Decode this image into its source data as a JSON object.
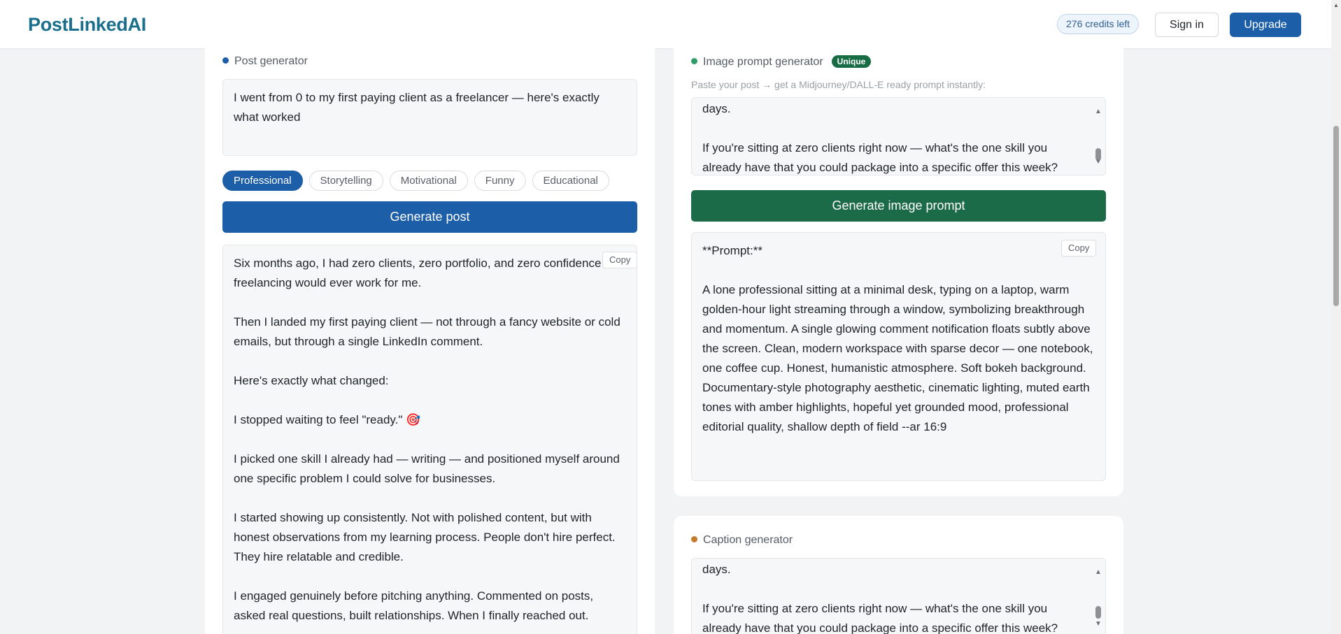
{
  "header": {
    "brand": "PostLinkedAI",
    "credits": "276 credits left",
    "signin": "Sign in",
    "upgrade": "Upgrade"
  },
  "post_generator": {
    "title": "Post generator",
    "dot_color": "#1d5ea8",
    "input_value": "I went from 0 to my first paying client as a freelancer — here's exactly what worked",
    "tones": [
      {
        "label": "Professional",
        "active": true
      },
      {
        "label": "Storytelling",
        "active": false
      },
      {
        "label": "Motivational",
        "active": false
      },
      {
        "label": "Funny",
        "active": false
      },
      {
        "label": "Educational",
        "active": false
      }
    ],
    "generate_label": "Generate post",
    "copy_label": "Copy",
    "output_text": "Six months ago, I had zero clients, zero portfolio, and zero confidence that freelancing would ever work for me.\n\nThen I landed my first paying client — not through a fancy website or cold emails, but through a single LinkedIn comment.\n\nHere's exactly what changed:\n\nI stopped waiting to feel \"ready.\" 🎯\n\nI picked one skill I already had — writing — and positioned myself around one specific problem I could solve for businesses.\n\nI started showing up consistently. Not with polished content, but with honest observations from my learning process. People don't hire perfect. They hire relatable and credible.\n\nI engaged genuinely before pitching anything. Commented on posts, asked real questions, built relationships. When I finally reached out."
  },
  "image_prompt_generator": {
    "title": "Image prompt generator",
    "dot_color": "#2e9d6a",
    "badge": "Unique",
    "hint": "Paste your post → get a Midjourney/DALL-E ready prompt instantly:",
    "input_value": "days.\n\nIf you're sitting at zero clients right now — what's the one skill you already have that you could package into a specific offer this week?",
    "generate_label": "Generate image prompt",
    "copy_label": "Copy",
    "output_text": "**Prompt:**\n\nA lone professional sitting at a minimal desk, typing on a laptop, warm golden-hour light streaming through a window, symbolizing breakthrough and momentum. A single glowing comment notification floats subtly above the screen. Clean, modern workspace with sparse decor — one notebook, one coffee cup. Honest, humanistic atmosphere. Soft bokeh background. Documentary-style photography aesthetic, cinematic lighting, muted earth tones with amber highlights, hopeful yet grounded mood, professional editorial quality, shallow depth of field --ar 16:9"
  },
  "caption_generator": {
    "title": "Caption generator",
    "dot_color": "#c77a2b",
    "input_value": "days.\n\nIf you're sitting at zero clients right now — what's the one skill you already have that you could package into a specific offer this week?"
  },
  "icons": {
    "scroll_up": "▲",
    "scroll_down": "▼"
  }
}
